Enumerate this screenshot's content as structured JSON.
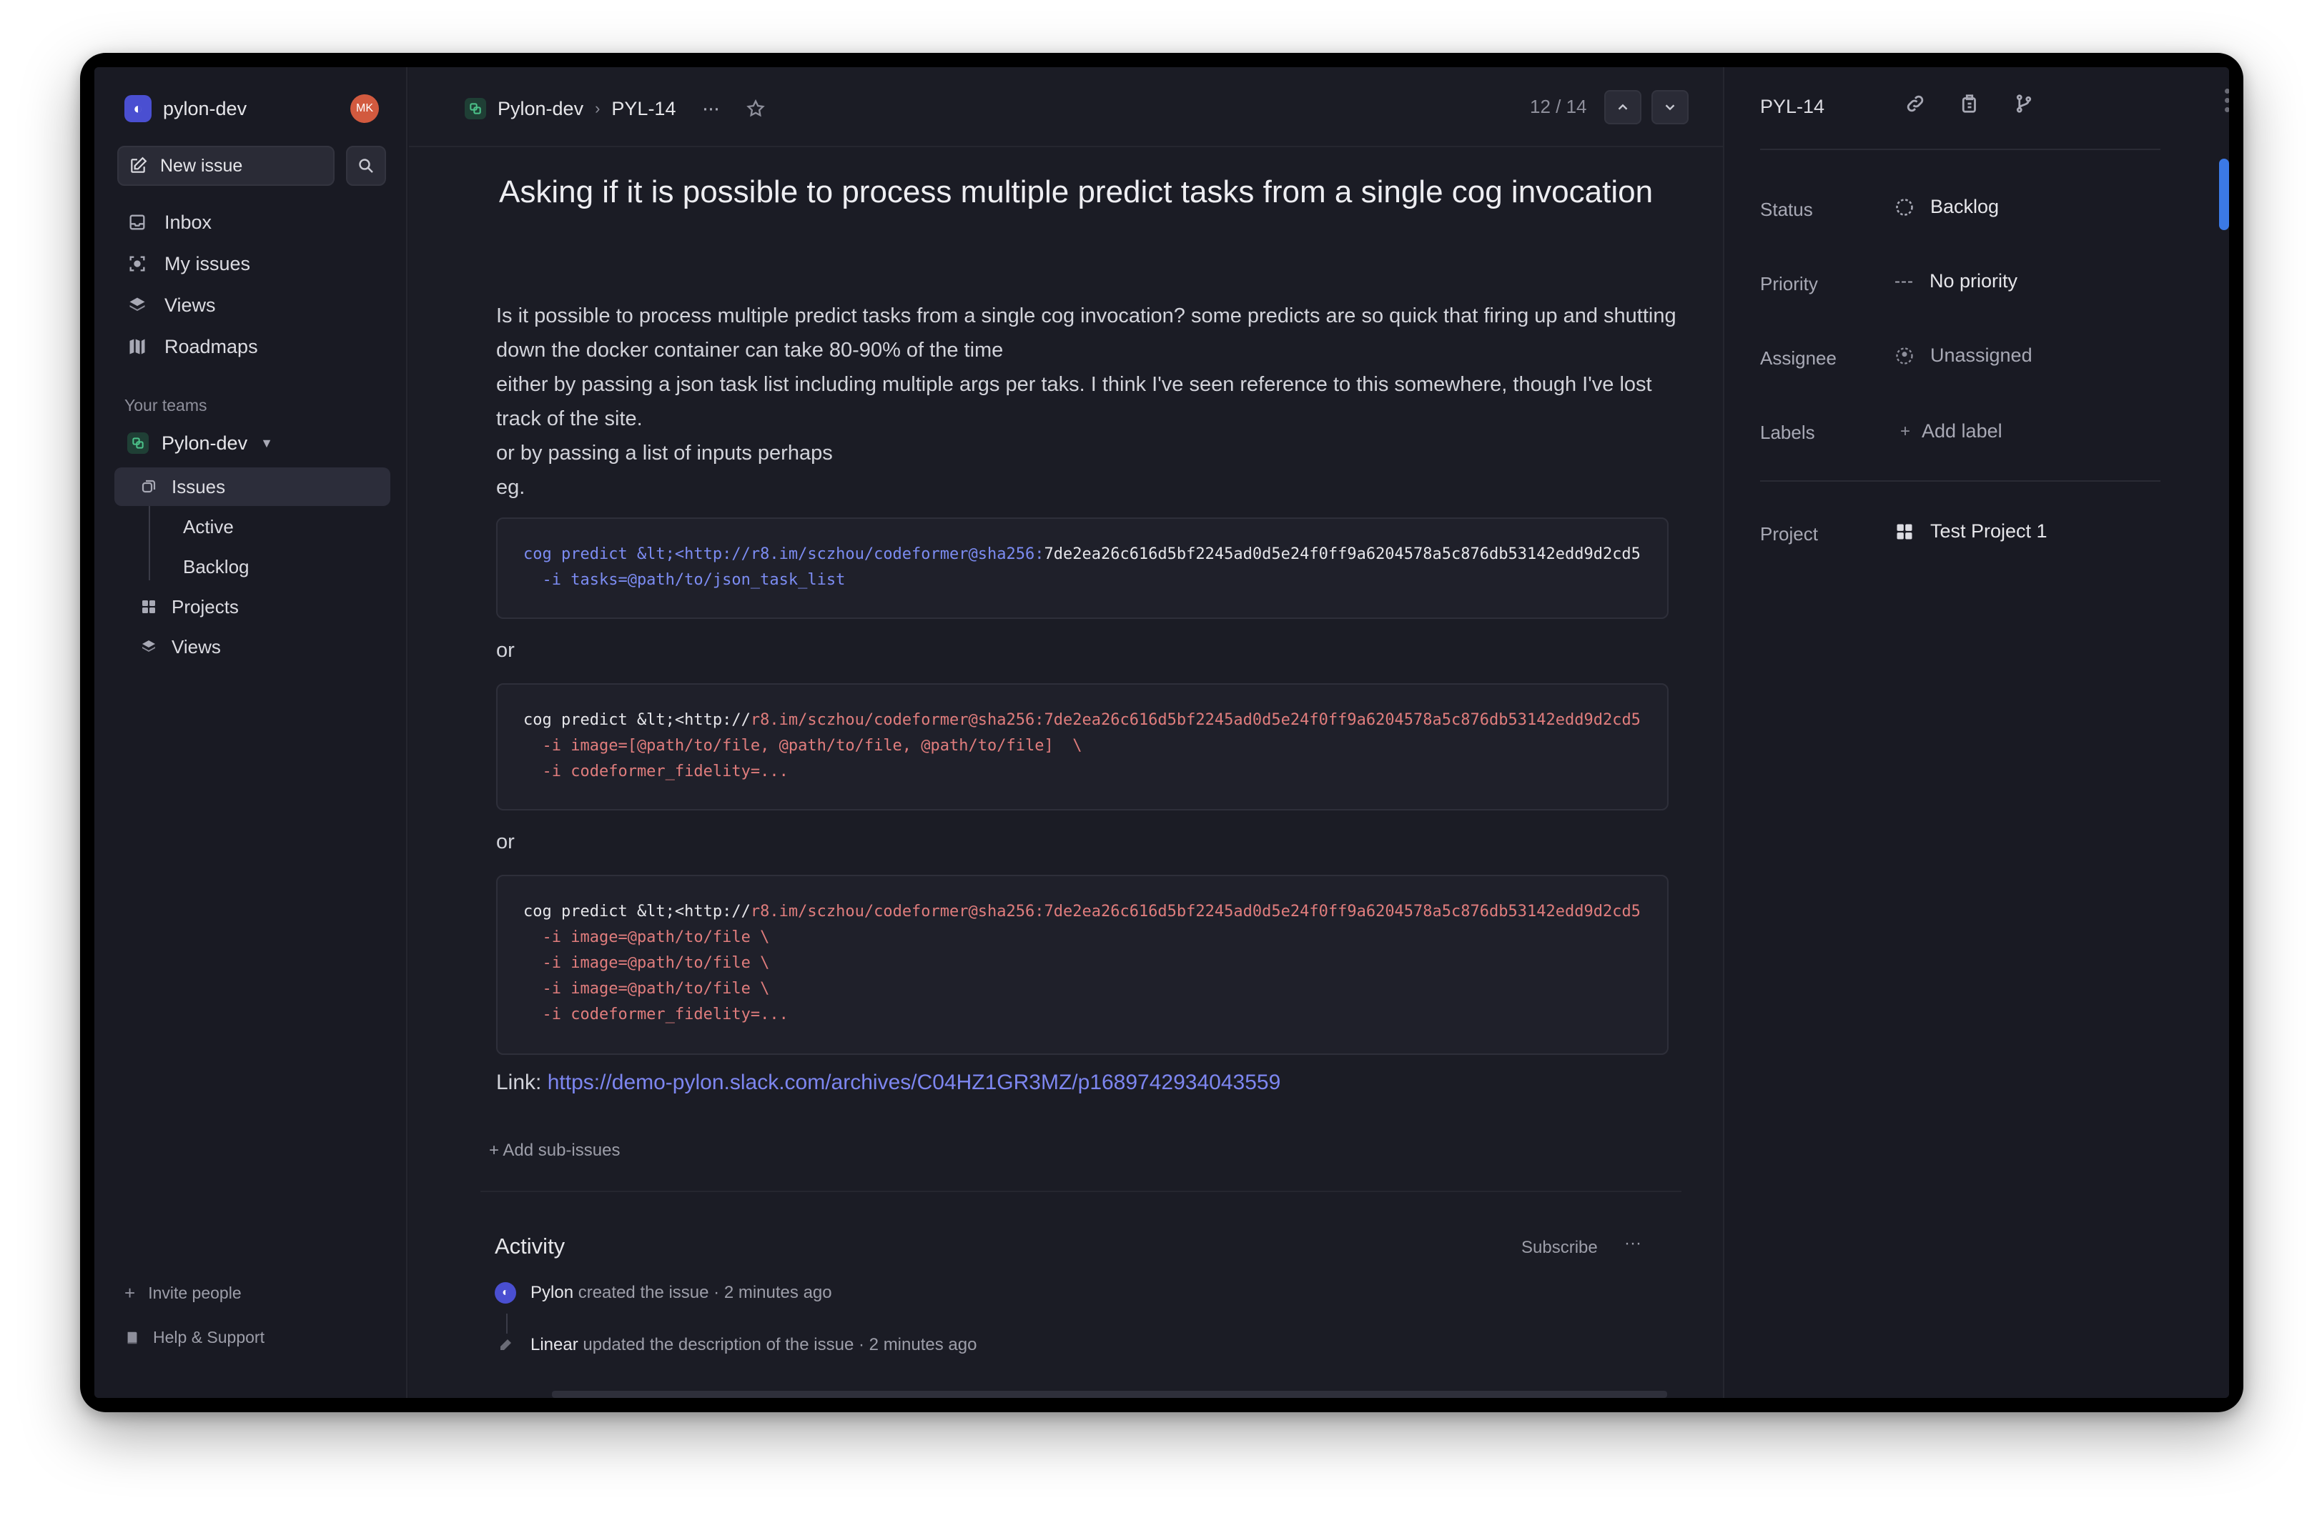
{
  "workspace": {
    "name": "pylon-dev",
    "avatar_initials": "MK"
  },
  "sidebar": {
    "new_issue_label": "New issue",
    "nav": [
      {
        "label": "Inbox",
        "icon": "inbox-icon"
      },
      {
        "label": "My issues",
        "icon": "my-issues-icon"
      },
      {
        "label": "Views",
        "icon": "layers-icon"
      },
      {
        "label": "Roadmaps",
        "icon": "map-icon"
      }
    ],
    "teams_label": "Your teams",
    "team": {
      "name": "Pylon-dev"
    },
    "team_items": {
      "issues": "Issues",
      "active": "Active",
      "backlog": "Backlog",
      "projects": "Projects",
      "views": "Views"
    },
    "footer": {
      "invite": "Invite people",
      "help": "Help & Support"
    }
  },
  "header": {
    "team": "Pylon-dev",
    "issue_id": "PYL-14",
    "counter": "12 / 14"
  },
  "issue": {
    "title": "Asking if it is possible to process multiple predict tasks from a single cog invocation",
    "description": [
      "Is it possible to process multiple predict tasks from a single cog invocation? some predicts are so quick that firing up and shutting down the docker container can take 80-90% of the time",
      "either by passing a json task list including multiple args per taks. I think I've seen reference to this somewhere, though I've lost track of the site.",
      "or by passing a list of inputs perhaps",
      "eg."
    ],
    "code_blocks": {
      "b1": {
        "prefix": "cog predict &lt;<http://r8.im/sczhou/codeformer@sha256:",
        "hash": "7de2ea26c616d5bf2245ad0d5e24f0ff9a6204578a5c876db53142edd9d2cd5",
        "line2": "  -i tasks=@path/to/json_task_list"
      },
      "b2": {
        "prefix": "cog predict &lt;<http://",
        "rest": "r8.im/sczhou/codeformer@sha256:7de2ea26c616d5bf2245ad0d5e24f0ff9a6204578a5c876db53142edd9d2cd5",
        "line2": "  -i image=[@path/to/file, @path/to/file, @path/to/file]  \\",
        "line3": "  -i codeformer_fidelity=..."
      },
      "b3": {
        "prefix": "cog predict &lt;<http://",
        "rest": "r8.im/sczhou/codeformer@sha256:7de2ea26c616d5bf2245ad0d5e24f0ff9a6204578a5c876db53142edd9d2cd5",
        "line2": "  -i image=@path/to/file \\",
        "line3": "  -i image=@path/to/file \\",
        "line4": "  -i image=@path/to/file \\",
        "line5": "  -i codeformer_fidelity=..."
      }
    },
    "or_text": "or",
    "link_label": "Link: ",
    "link_url": "https://demo-pylon.slack.com/archives/C04HZ1GR3MZ/p1689742934043559",
    "add_sub_issues": "+ Add sub-issues"
  },
  "activity": {
    "heading": "Activity",
    "subscribe": "Subscribe",
    "more": "···",
    "items": [
      {
        "actor": "Pylon",
        "action": "created the issue",
        "sep": "·",
        "time": "2 minutes ago"
      },
      {
        "actor": "Linear",
        "action": "updated the description of the issue",
        "sep": "·",
        "time": "2 minutes ago"
      }
    ]
  },
  "details": {
    "issue_id": "PYL-14",
    "status": {
      "label": "Status",
      "value": "Backlog"
    },
    "priority": {
      "label": "Priority",
      "value": "No priority"
    },
    "assignee": {
      "label": "Assignee",
      "value": "Unassigned"
    },
    "labels": {
      "label": "Labels",
      "value": "Add label"
    },
    "project": {
      "label": "Project",
      "value": "Test Project 1"
    }
  },
  "colors": {
    "accent": "#5e6ad2",
    "link": "#7d86f0",
    "background": "#191a23"
  }
}
